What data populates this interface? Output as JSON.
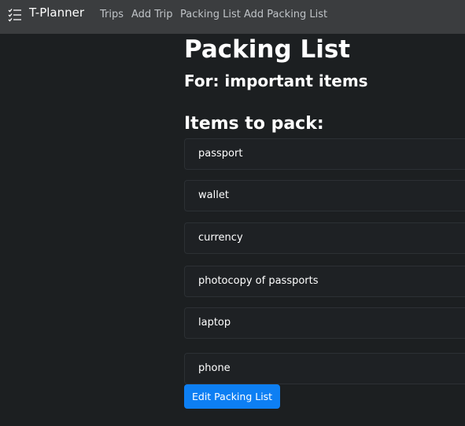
{
  "navbar": {
    "brand_icon": "checklist-icon",
    "brand": "T-Planner",
    "links": [
      "Trips",
      "Add Trip",
      "Packing List",
      "Add Packing List"
    ]
  },
  "main": {
    "title": "Packing List",
    "subtitle": "For: important items",
    "section_title": "Items to pack:",
    "items": [
      "passport",
      "wallet",
      "currency",
      "photocopy of passports",
      "laptop",
      "phone"
    ],
    "edit_button": "Edit Packing List"
  },
  "colors": {
    "background": "#1c1f21",
    "navbar": "#3b3d3f",
    "accent": "#0d7ff3"
  }
}
